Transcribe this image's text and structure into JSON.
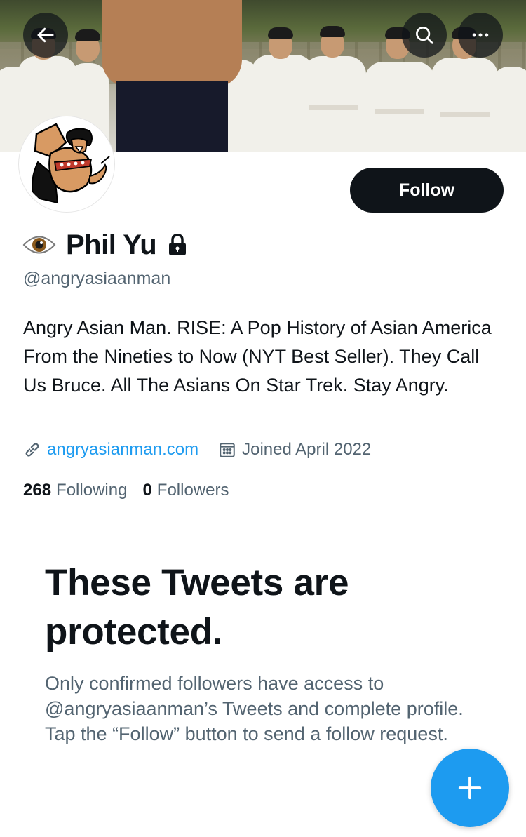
{
  "colors": {
    "primary_text": "#0f1419",
    "secondary_text": "#536471",
    "accent": "#1d9bf0",
    "follow_button_bg": "#0f1419"
  },
  "header": {
    "back_icon": "arrow-left-icon",
    "search_icon": "search-icon",
    "more_icon": "more-horizontal-icon"
  },
  "profile": {
    "name_emoji_icon": "eye-icon",
    "display_name": "Phil Yu",
    "protected_icon": "lock-icon",
    "handle": "@angryasiaanman",
    "follow_label": "Follow",
    "bio": "Angry Asian Man. RISE: A Pop History of Asian America From the Nineties to Now (NYT Best Seller). They Call Us Bruce. All The Asians On Star Trek. Stay Angry.",
    "website": "angryasianman.com",
    "joined": "Joined April 2022",
    "following_count": "268",
    "following_label": "Following",
    "followers_count": "0",
    "followers_label": "Followers"
  },
  "protected_notice": {
    "title": "These Tweets are protected.",
    "body": "Only confirmed followers have access to @angryasiaanman’s Tweets and complete profile. Tap the “Follow” button to send a follow request."
  },
  "fab": {
    "icon": "plus-icon"
  }
}
